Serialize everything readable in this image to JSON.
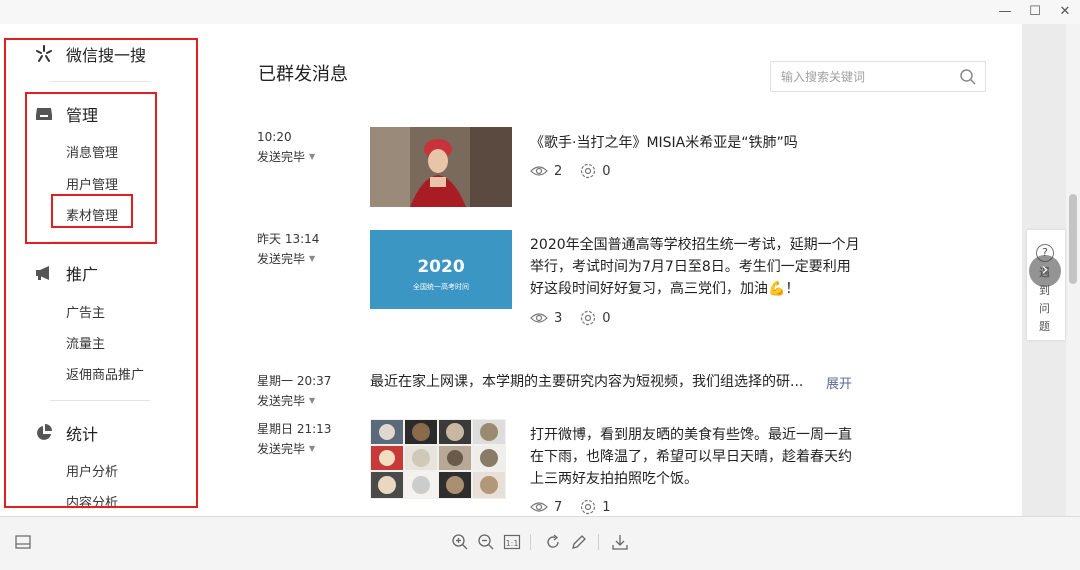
{
  "window": {
    "minimize": "—",
    "maximize": "☐",
    "close": "✕"
  },
  "sidebar": {
    "brand": "微信搜一搜",
    "sections": [
      {
        "title": "管理",
        "items": [
          "消息管理",
          "用户管理",
          "素材管理"
        ]
      },
      {
        "title": "推广",
        "items": [
          "广告主",
          "流量主",
          "返佣商品推广"
        ]
      },
      {
        "title": "统计",
        "items": [
          "用户分析",
          "内容分析"
        ]
      }
    ]
  },
  "main": {
    "title": "已群发消息",
    "search": {
      "placeholder": "输入搜索关键词"
    },
    "messages": [
      {
        "time": "10:20",
        "status": "发送完毕",
        "title": "《歌手·当打之年》MISIA米希亚是“铁肺”吗",
        "views": "2",
        "likes": "0"
      },
      {
        "time": "昨天 13:14",
        "status": "发送完毕",
        "thumb_big": "2020",
        "thumb_small": "全国统一高考时间",
        "body": "2020年全国普通高等学校招生统一考试，延期一个月举行，考试时间为7月7日至8日。考生们一定要利用好这段时间好好复习，高三党们，加油💪！",
        "views": "3",
        "likes": "0"
      },
      {
        "time": "星期一 20:37",
        "status": "发送完毕",
        "text": "最近在家上网课，本学期的主要研究内容为短视频，我们组选择的研...",
        "expand": "展开"
      },
      {
        "time": "星期日 21:13",
        "status": "发送完毕",
        "body": "打开微博，看到朋友晒的美食有些馋。最近一周一直在下雨，也降温了，希望可以早日天晴，趁着春天约上三两好友拍拍照吃个饭。",
        "views": "7",
        "likes": "1"
      }
    ]
  },
  "help": {
    "label": "遇到问题"
  },
  "colors": {
    "red_box": "#e02020",
    "link": "#576b95",
    "thumb_blue": "#3b96c3"
  }
}
